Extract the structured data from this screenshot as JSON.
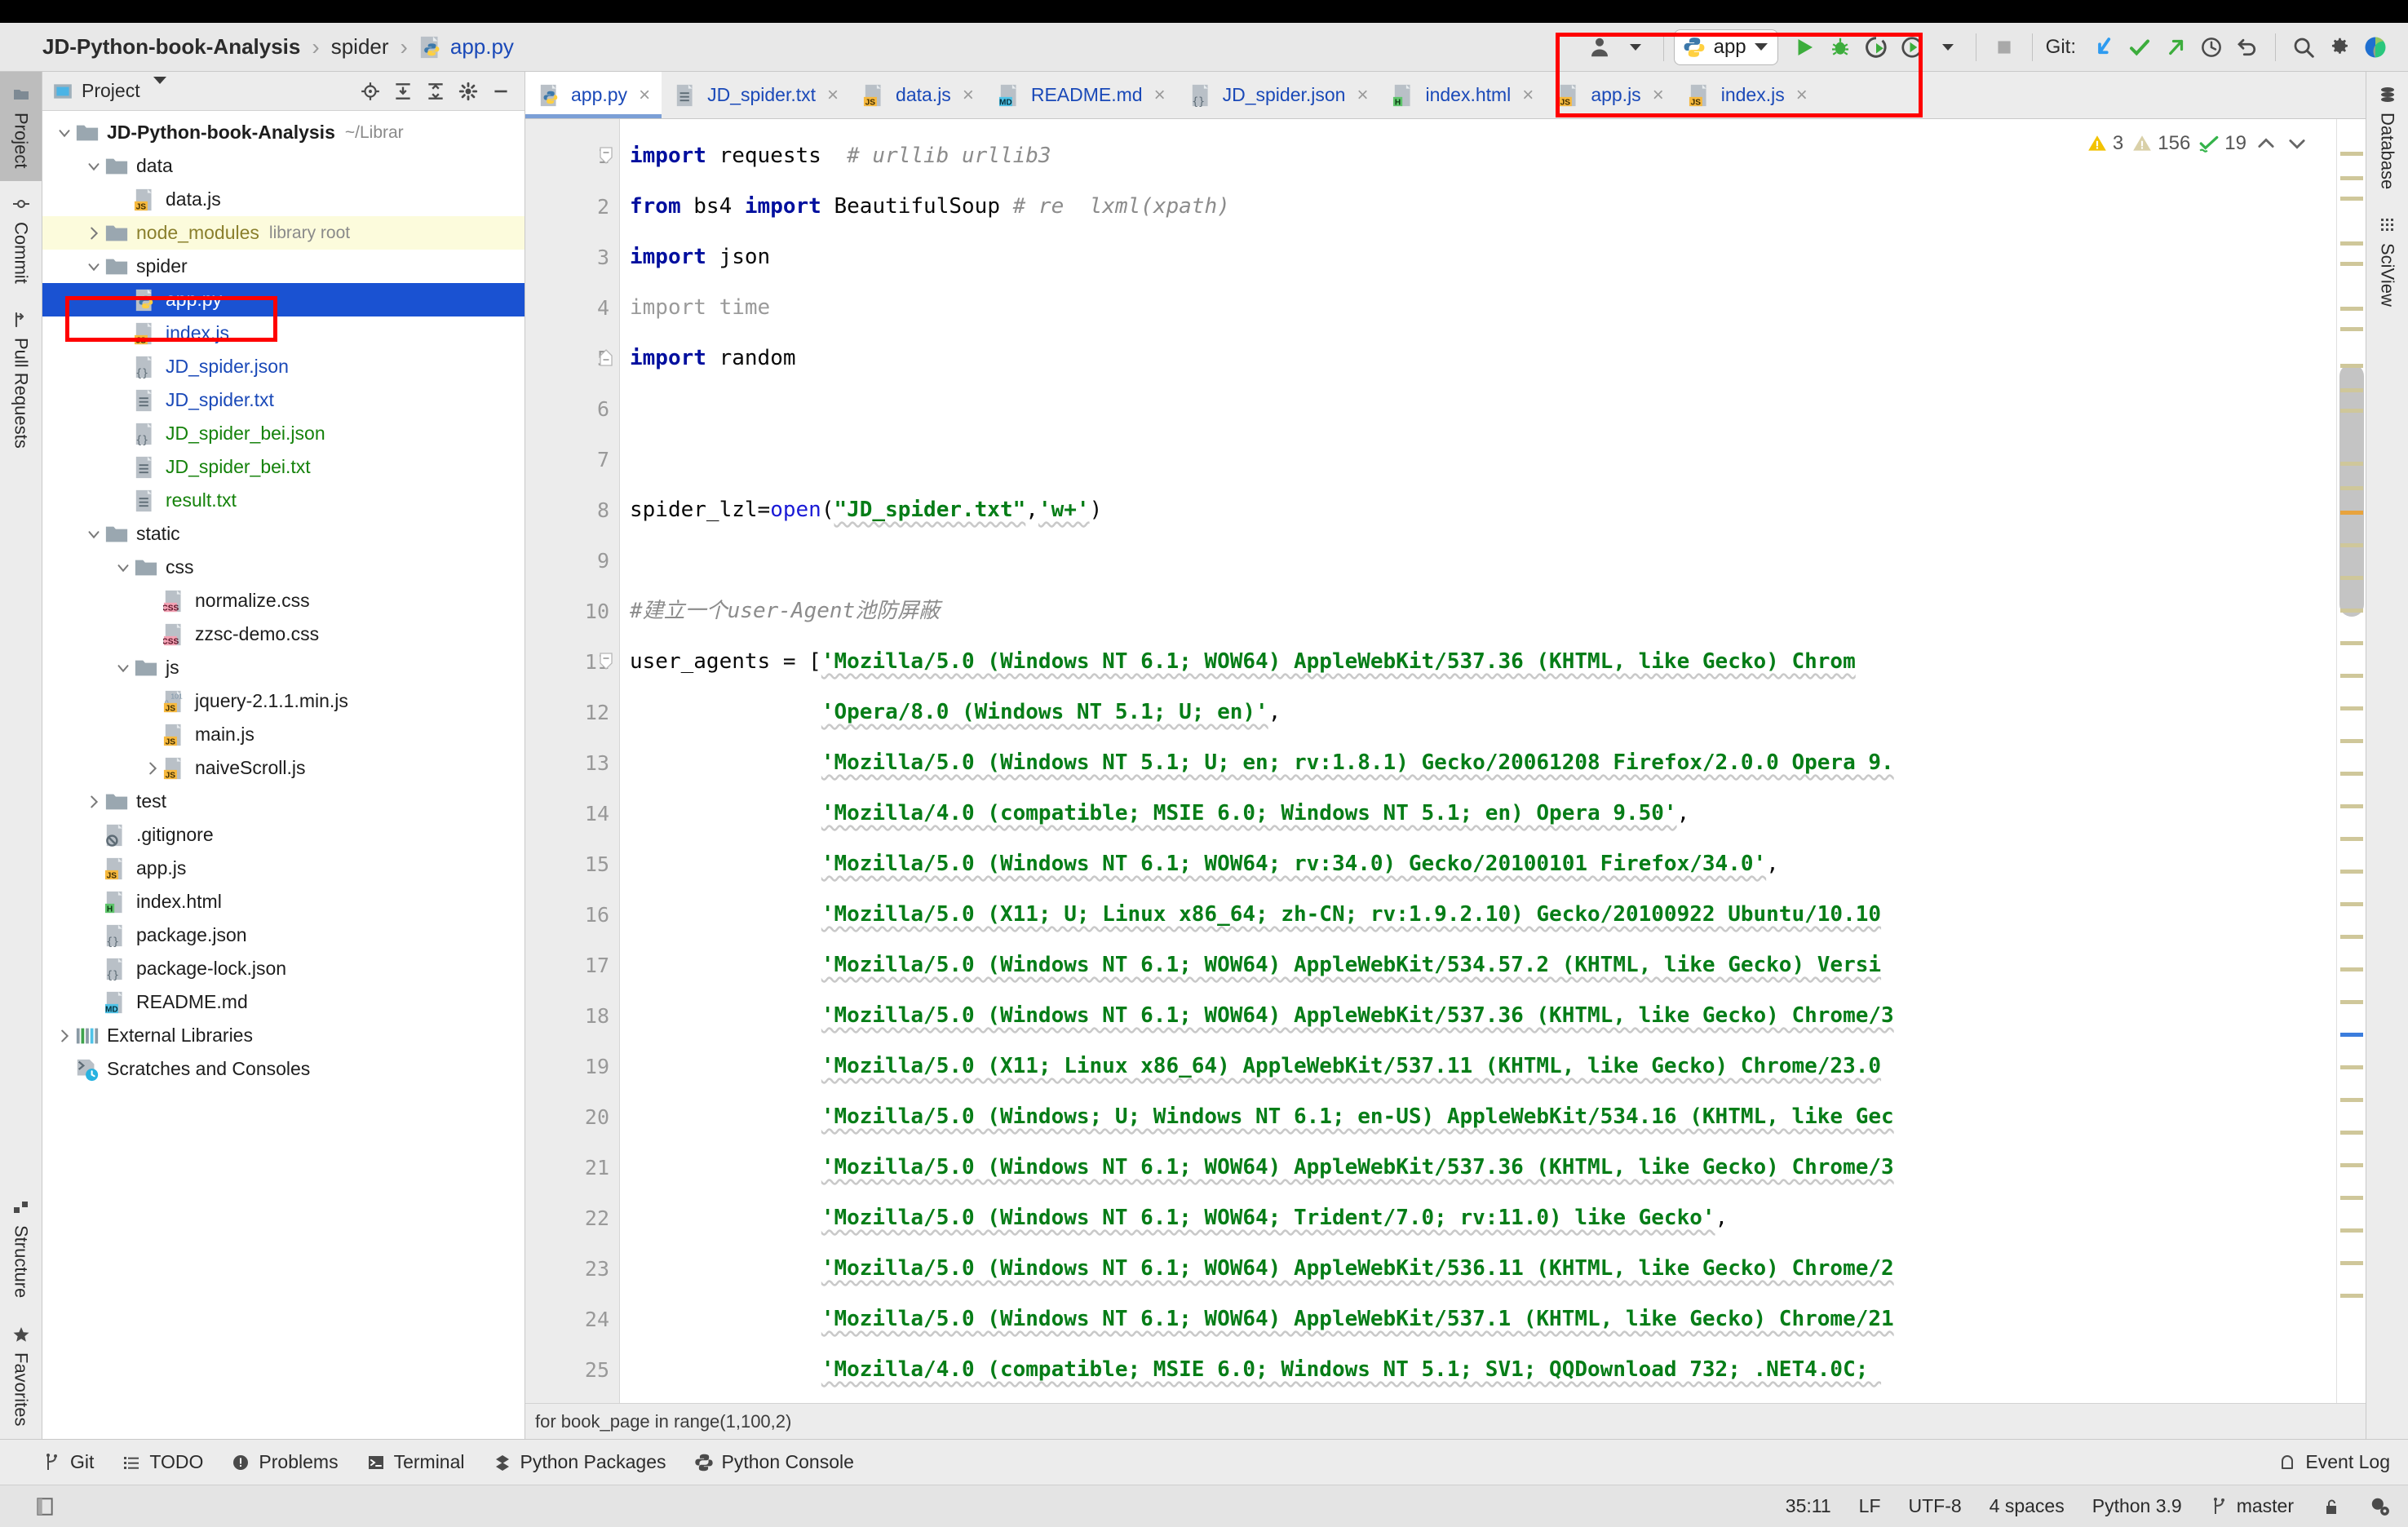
{
  "breadcrumb": {
    "items": [
      {
        "label": "JD-Python-book-Analysis",
        "style": "bold"
      },
      {
        "label": "spider",
        "style": "plain"
      },
      {
        "label": "app.py",
        "style": "link",
        "icon": "python-file-icon"
      }
    ],
    "separator": "›"
  },
  "toolbar": {
    "run_config_name": "app",
    "run_icon": "run-icon",
    "debug_icon": "debug-icon",
    "coverage_icon": "run-coverage-icon",
    "profile_icon": "profile-icon",
    "stop_icon": "stop-icon",
    "git_label": "Git:",
    "git_update_icon": "git-update-project-icon",
    "git_commit_icon": "git-commit-icon",
    "git_push_icon": "git-push-icon",
    "git_history_icon": "git-history-icon",
    "git_rollback_icon": "git-rollback-icon",
    "search_icon": "search-everywhere-icon",
    "settings_icon": "gear-icon",
    "avatar_icon": "user-account-icon",
    "ide_icon": "ide-logo-icon"
  },
  "left_strip": {
    "top": [
      {
        "label": "Project",
        "icon": "project-folder-icon",
        "active": true
      },
      {
        "label": "Commit",
        "icon": "commit-icon",
        "active": false
      },
      {
        "label": "Pull Requests",
        "icon": "pull-request-icon",
        "active": false
      }
    ],
    "bottom": [
      {
        "label": "Structure",
        "icon": "structure-icon",
        "active": false
      },
      {
        "label": "Favorites",
        "icon": "star-icon",
        "active": false
      }
    ]
  },
  "right_strip": {
    "items": [
      {
        "label": "Database",
        "icon": "database-icon"
      },
      {
        "label": "SciView",
        "icon": "sciview-icon"
      }
    ]
  },
  "project_panel": {
    "title": "Project",
    "title_caret": "chevron-down-icon",
    "tools": [
      "locate-icon",
      "expand-all-icon",
      "collapse-all-icon",
      "gear-icon",
      "hide-icon"
    ],
    "tree": [
      {
        "depth": 0,
        "arrow": "down",
        "icon": "folder-icon",
        "label": "JD-Python-book-Analysis",
        "hint": "~/Librar",
        "style": "bold"
      },
      {
        "depth": 1,
        "arrow": "down",
        "icon": "folder-icon",
        "label": "data",
        "style": "plain"
      },
      {
        "depth": 2,
        "arrow": "none",
        "icon": "js-file-icon",
        "label": "data.js",
        "style": "plain"
      },
      {
        "depth": 1,
        "arrow": "right",
        "icon": "folder-icon",
        "label": "node_modules",
        "hint": "library root",
        "style": "node-modules"
      },
      {
        "depth": 1,
        "arrow": "down",
        "icon": "folder-icon",
        "label": "spider",
        "style": "plain"
      },
      {
        "depth": 2,
        "arrow": "none",
        "icon": "python-file-icon",
        "label": "app.py",
        "style": "selected"
      },
      {
        "depth": 2,
        "arrow": "none",
        "icon": "js-file-icon",
        "label": "index.js",
        "style": "blue"
      },
      {
        "depth": 2,
        "arrow": "none",
        "icon": "json-file-icon",
        "label": "JD_spider.json",
        "style": "blue"
      },
      {
        "depth": 2,
        "arrow": "none",
        "icon": "text-file-icon",
        "label": "JD_spider.txt",
        "style": "blue"
      },
      {
        "depth": 2,
        "arrow": "none",
        "icon": "json-file-icon",
        "label": "JD_spider_bei.json",
        "style": "green"
      },
      {
        "depth": 2,
        "arrow": "none",
        "icon": "text-file-icon",
        "label": "JD_spider_bei.txt",
        "style": "green"
      },
      {
        "depth": 2,
        "arrow": "none",
        "icon": "text-file-icon",
        "label": "result.txt",
        "style": "green"
      },
      {
        "depth": 1,
        "arrow": "down",
        "icon": "folder-icon",
        "label": "static",
        "style": "plain"
      },
      {
        "depth": 2,
        "arrow": "down",
        "icon": "folder-icon",
        "label": "css",
        "style": "plain"
      },
      {
        "depth": 3,
        "arrow": "none",
        "icon": "css-file-icon",
        "label": "normalize.css",
        "style": "plain"
      },
      {
        "depth": 3,
        "arrow": "none",
        "icon": "css-file-icon",
        "label": "zzsc-demo.css",
        "style": "plain"
      },
      {
        "depth": 2,
        "arrow": "down",
        "icon": "folder-icon",
        "label": "js",
        "style": "plain"
      },
      {
        "depth": 3,
        "arrow": "none",
        "icon": "js-min-file-icon",
        "label": "jquery-2.1.1.min.js",
        "style": "plain"
      },
      {
        "depth": 3,
        "arrow": "none",
        "icon": "js-file-icon",
        "label": "main.js",
        "style": "plain"
      },
      {
        "depth": 3,
        "arrow": "right",
        "icon": "js-file-icon",
        "label": "naiveScroll.js",
        "style": "plain"
      },
      {
        "depth": 1,
        "arrow": "right",
        "icon": "folder-icon",
        "label": "test",
        "style": "plain"
      },
      {
        "depth": 1,
        "arrow": "none",
        "icon": "gitignore-file-icon",
        "label": ".gitignore",
        "style": "plain"
      },
      {
        "depth": 1,
        "arrow": "none",
        "icon": "js-file-icon",
        "label": "app.js",
        "style": "plain"
      },
      {
        "depth": 1,
        "arrow": "none",
        "icon": "html-file-icon",
        "label": "index.html",
        "style": "plain"
      },
      {
        "depth": 1,
        "arrow": "none",
        "icon": "json-file-icon",
        "label": "package.json",
        "style": "plain"
      },
      {
        "depth": 1,
        "arrow": "none",
        "icon": "json-file-icon",
        "label": "package-lock.json",
        "style": "plain"
      },
      {
        "depth": 1,
        "arrow": "none",
        "icon": "md-file-icon",
        "label": "README.md",
        "style": "plain"
      },
      {
        "depth": 0,
        "arrow": "right",
        "icon": "external-libraries-icon",
        "label": "External Libraries",
        "style": "plain"
      },
      {
        "depth": 0,
        "arrow": "none",
        "icon": "scratches-icon",
        "label": "Scratches and Consoles",
        "style": "plain"
      }
    ]
  },
  "editor_tabs": [
    {
      "label": "app.py",
      "icon": "python-file-icon",
      "active": true
    },
    {
      "label": "JD_spider.txt",
      "icon": "text-file-icon",
      "active": false
    },
    {
      "label": "data.js",
      "icon": "js-file-icon",
      "active": false
    },
    {
      "label": "README.md",
      "icon": "md-file-icon",
      "active": false
    },
    {
      "label": "JD_spider.json",
      "icon": "json-file-icon",
      "active": false
    },
    {
      "label": "index.html",
      "icon": "html-file-icon",
      "active": false
    },
    {
      "label": "app.js",
      "icon": "js-file-icon",
      "active": false
    },
    {
      "label": "index.js",
      "icon": "js-file-icon",
      "active": false
    }
  ],
  "tab_close_glyph": "×",
  "inspections": {
    "warning_count": "3",
    "weak_warning_count": "156",
    "typo_count": "19",
    "warning_icon": "warning-triangle-icon",
    "weak_warning_icon": "weak-warning-triangle-icon",
    "typo_icon": "typo-check-icon",
    "prev_icon": "chevron-up-icon",
    "next_icon": "chevron-down-icon"
  },
  "code": {
    "first_line": 1,
    "lines": [
      {
        "n": 1,
        "fold": "start",
        "tokens": [
          {
            "t": "import",
            "c": "kw"
          },
          {
            "t": " requests  ",
            "c": "plain"
          },
          {
            "t": "# urllib urllib3",
            "c": "cm"
          }
        ]
      },
      {
        "n": 2,
        "fold": "none",
        "tokens": [
          {
            "t": "from",
            "c": "kw"
          },
          {
            "t": " bs4 ",
            "c": "plain"
          },
          {
            "t": "import",
            "c": "kw"
          },
          {
            "t": " BeautifulSoup ",
            "c": "plain"
          },
          {
            "t": "# re  lxml(xpath)",
            "c": "cm"
          }
        ]
      },
      {
        "n": 3,
        "fold": "none",
        "tokens": [
          {
            "t": "import",
            "c": "kw"
          },
          {
            "t": " json",
            "c": "plain"
          }
        ]
      },
      {
        "n": 4,
        "fold": "none",
        "tokens": [
          {
            "t": "import",
            "c": "kw-dim"
          },
          {
            "t": " time",
            "c": "dim"
          }
        ]
      },
      {
        "n": 5,
        "fold": "end",
        "tokens": [
          {
            "t": "import",
            "c": "kw"
          },
          {
            "t": " random",
            "c": "plain"
          }
        ]
      },
      {
        "n": 6,
        "fold": "none",
        "tokens": []
      },
      {
        "n": 7,
        "fold": "none",
        "tokens": []
      },
      {
        "n": 8,
        "fold": "none",
        "tokens": [
          {
            "t": "spider_lzl=",
            "c": "plain"
          },
          {
            "t": "open",
            "c": "kw2"
          },
          {
            "t": "(",
            "c": "plain"
          },
          {
            "t": "\"JD_spider.txt\"",
            "c": "str"
          },
          {
            "t": ",",
            "c": "plain"
          },
          {
            "t": "'w+'",
            "c": "str"
          },
          {
            "t": ")",
            "c": "plain"
          }
        ]
      },
      {
        "n": 9,
        "fold": "none",
        "tokens": []
      },
      {
        "n": 10,
        "fold": "none",
        "tokens": [
          {
            "t": "#建立一个user-Agent池防屏蔽",
            "c": "cm"
          }
        ]
      },
      {
        "n": 11,
        "fold": "start",
        "tokens": [
          {
            "t": "user_agents = [",
            "c": "plain"
          },
          {
            "t": "'Mozilla/5.0 (Windows NT 6.1; WOW64) AppleWebKit/537.36 (KHTML, like Gecko) Chrom",
            "c": "str"
          }
        ]
      },
      {
        "n": 12,
        "fold": "none",
        "tokens": [
          {
            "t": "               ",
            "c": "plain"
          },
          {
            "t": "'Opera/8.0 (Windows NT 5.1; U; en)'",
            "c": "str"
          },
          {
            "t": ",",
            "c": "plain"
          }
        ]
      },
      {
        "n": 13,
        "fold": "none",
        "tokens": [
          {
            "t": "               ",
            "c": "plain"
          },
          {
            "t": "'Mozilla/5.0 (Windows NT 5.1; U; en; rv:1.8.1) Gecko/20061208 Firefox/2.0.0 Opera 9.",
            "c": "str"
          }
        ]
      },
      {
        "n": 14,
        "fold": "none",
        "tokens": [
          {
            "t": "               ",
            "c": "plain"
          },
          {
            "t": "'Mozilla/4.0 (compatible; MSIE 6.0; Windows NT 5.1; en) Opera 9.50'",
            "c": "str"
          },
          {
            "t": ",",
            "c": "plain"
          }
        ]
      },
      {
        "n": 15,
        "fold": "none",
        "tokens": [
          {
            "t": "               ",
            "c": "plain"
          },
          {
            "t": "'Mozilla/5.0 (Windows NT 6.1; WOW64; rv:34.0) Gecko/20100101 Firefox/34.0'",
            "c": "str"
          },
          {
            "t": ",",
            "c": "plain"
          }
        ]
      },
      {
        "n": 16,
        "fold": "none",
        "tokens": [
          {
            "t": "               ",
            "c": "plain"
          },
          {
            "t": "'Mozilla/5.0 (X11; U; Linux x86_64; zh-CN; rv:1.9.2.10) Gecko/20100922 Ubuntu/10.10",
            "c": "str"
          }
        ]
      },
      {
        "n": 17,
        "fold": "none",
        "tokens": [
          {
            "t": "               ",
            "c": "plain"
          },
          {
            "t": "'Mozilla/5.0 (Windows NT 6.1; WOW64) AppleWebKit/534.57.2 (KHTML, like Gecko) Versi",
            "c": "str"
          }
        ]
      },
      {
        "n": 18,
        "fold": "none",
        "tokens": [
          {
            "t": "               ",
            "c": "plain"
          },
          {
            "t": "'Mozilla/5.0 (Windows NT 6.1; WOW64) AppleWebKit/537.36 (KHTML, like Gecko) Chrome/3",
            "c": "str"
          }
        ]
      },
      {
        "n": 19,
        "fold": "none",
        "tokens": [
          {
            "t": "               ",
            "c": "plain"
          },
          {
            "t": "'Mozilla/5.0 (X11; Linux x86_64) AppleWebKit/537.11 (KHTML, like Gecko) Chrome/23.0",
            "c": "str"
          }
        ]
      },
      {
        "n": 20,
        "fold": "none",
        "tokens": [
          {
            "t": "               ",
            "c": "plain"
          },
          {
            "t": "'Mozilla/5.0 (Windows; U; Windows NT 6.1; en-US) AppleWebKit/534.16 (KHTML, like Gec",
            "c": "str"
          }
        ]
      },
      {
        "n": 21,
        "fold": "none",
        "tokens": [
          {
            "t": "               ",
            "c": "plain"
          },
          {
            "t": "'Mozilla/5.0 (Windows NT 6.1; WOW64) AppleWebKit/537.36 (KHTML, like Gecko) Chrome/3",
            "c": "str"
          }
        ]
      },
      {
        "n": 22,
        "fold": "none",
        "tokens": [
          {
            "t": "               ",
            "c": "plain"
          },
          {
            "t": "'Mozilla/5.0 (Windows NT 6.1; WOW64; Trident/7.0; rv:11.0) like Gecko'",
            "c": "str"
          },
          {
            "t": ",",
            "c": "plain"
          }
        ]
      },
      {
        "n": 23,
        "fold": "none",
        "tokens": [
          {
            "t": "               ",
            "c": "plain"
          },
          {
            "t": "'Mozilla/5.0 (Windows NT 6.1; WOW64) AppleWebKit/536.11 (KHTML, like Gecko) Chrome/2",
            "c": "str"
          }
        ]
      },
      {
        "n": 24,
        "fold": "none",
        "tokens": [
          {
            "t": "               ",
            "c": "plain"
          },
          {
            "t": "'Mozilla/5.0 (Windows NT 6.1; WOW64) AppleWebKit/537.1 (KHTML, like Gecko) Chrome/21",
            "c": "str"
          }
        ]
      },
      {
        "n": 25,
        "fold": "none",
        "tokens": [
          {
            "t": "               ",
            "c": "plain"
          },
          {
            "t": "'Mozilla/4.0 (compatible; MSIE 6.0; Windows NT 5.1; SV1; QQDownload 732; .NET4.0C; ",
            "c": "str"
          }
        ]
      }
    ]
  },
  "editor_footer": {
    "breadcrumb": "for book_page in range(1,100,2)"
  },
  "tool_window_bar": {
    "items": [
      {
        "label": "Git",
        "icon": "git-branch-icon"
      },
      {
        "label": "TODO",
        "icon": "todo-list-icon"
      },
      {
        "label": "Problems",
        "icon": "problems-icon"
      },
      {
        "label": "Terminal",
        "icon": "terminal-icon"
      },
      {
        "label": "Python Packages",
        "icon": "python-packages-icon"
      },
      {
        "label": "Python Console",
        "icon": "python-console-icon"
      }
    ],
    "event_log": {
      "label": "Event Log",
      "icon": "event-log-icon"
    }
  },
  "status_bar": {
    "left_icon": "toggle-toolwindows-icon",
    "caret_position": "35:11",
    "line_separator": "LF",
    "encoding": "UTF-8",
    "indent": "4 spaces",
    "interpreter": "Python 3.9",
    "branch": "master",
    "branch_icon": "git-branch-icon",
    "lock_icon": "unlocked-icon",
    "inspection_icon": "inspection-level-icon"
  },
  "colors": {
    "selection_blue": "#1a52d2",
    "annotation_red": "#ff0000",
    "string_green": "#067d17",
    "keyword_blue": "#000f9e",
    "link_blue": "#1a49b8"
  }
}
